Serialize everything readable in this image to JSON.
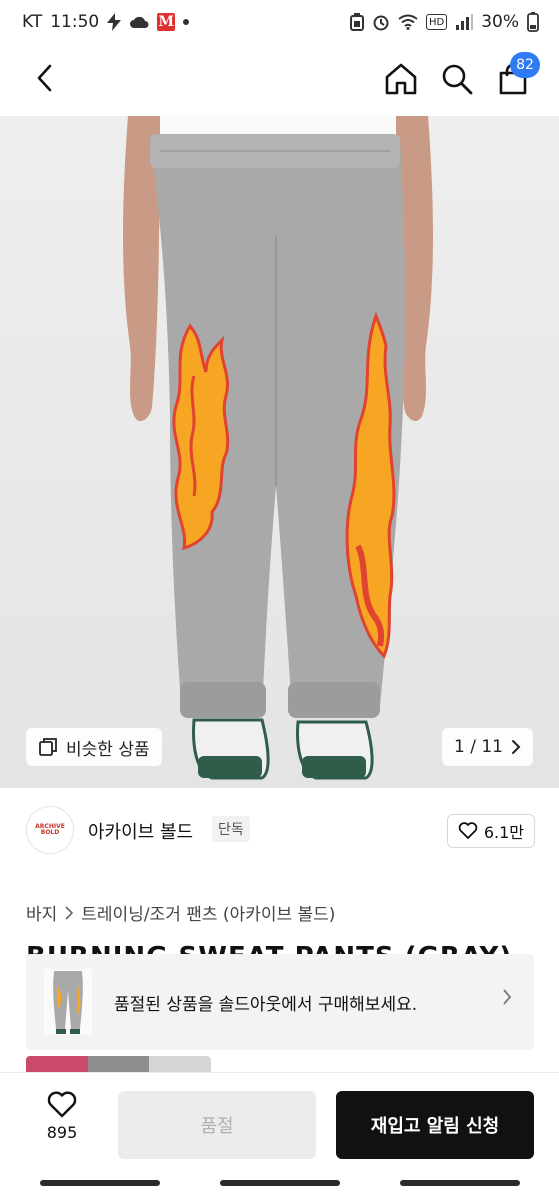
{
  "status": {
    "carrier": "KT",
    "time": "11:50",
    "m_badge": "M",
    "network": "HD",
    "battery": "30%"
  },
  "header": {
    "cart_count": "82"
  },
  "hero": {
    "similar_label": "비슷한 상품",
    "pager": "1 / 11"
  },
  "brand": {
    "logo_text": "ARCHIVE BOLD",
    "name": "아카이브 볼드",
    "exclusive": "단독",
    "likes": "6.1만"
  },
  "category": {
    "level1": "바지",
    "level2": "트레이닝/조거 팬츠 (아카이브 볼드)"
  },
  "product": {
    "title": "BURNING SWEAT PANTS (GRAY)"
  },
  "soldout_banner": {
    "text": "품절된 상품을 솔드아웃에서 구매해보세요."
  },
  "bottom_bar": {
    "wish_count": "895",
    "soldout_label": "품절",
    "restock_label": "재입고 알림 신청"
  },
  "colors": {
    "badge_blue": "#2f7bf5",
    "flame_orange": "#f6a623",
    "flame_red": "#e0432f",
    "pants_gray": "#a9a9a9"
  }
}
